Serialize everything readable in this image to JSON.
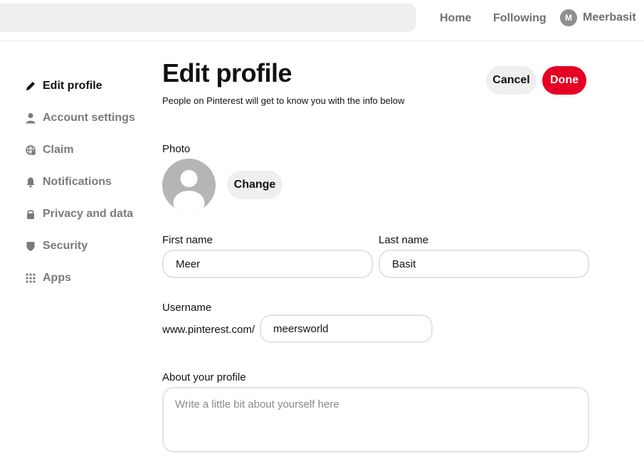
{
  "header": {
    "nav": {
      "home": "Home",
      "following": "Following"
    },
    "user": {
      "initial": "M",
      "name": "Meerbasit"
    }
  },
  "sidebar": {
    "items": [
      {
        "label": "Edit profile",
        "icon": "pencil-icon",
        "active": true
      },
      {
        "label": "Account settings",
        "icon": "person-icon",
        "active": false
      },
      {
        "label": "Claim",
        "icon": "globe-icon",
        "active": false
      },
      {
        "label": "Notifications",
        "icon": "bell-icon",
        "active": false
      },
      {
        "label": "Privacy and data",
        "icon": "lock-icon",
        "active": false
      },
      {
        "label": "Security",
        "icon": "shield-icon",
        "active": false
      },
      {
        "label": "Apps",
        "icon": "grid-icon",
        "active": false
      }
    ]
  },
  "main": {
    "title": "Edit profile",
    "subtitle": "People on Pinterest will get to know you with the info below",
    "cancel_label": "Cancel",
    "done_label": "Done",
    "photo_label": "Photo",
    "change_label": "Change",
    "first_name_label": "First name",
    "first_name_value": "Meer",
    "last_name_label": "Last name",
    "last_name_value": "Basit",
    "username_label": "Username",
    "url_prefix": "www.pinterest.com/",
    "username_value": "meersworld",
    "about_label": "About your profile",
    "about_placeholder": "Write a little bit about yourself here"
  },
  "colors": {
    "accent": "#e60023",
    "muted_text": "#767676",
    "field_border": "#e4e4e4",
    "button_gray": "#efefef"
  }
}
